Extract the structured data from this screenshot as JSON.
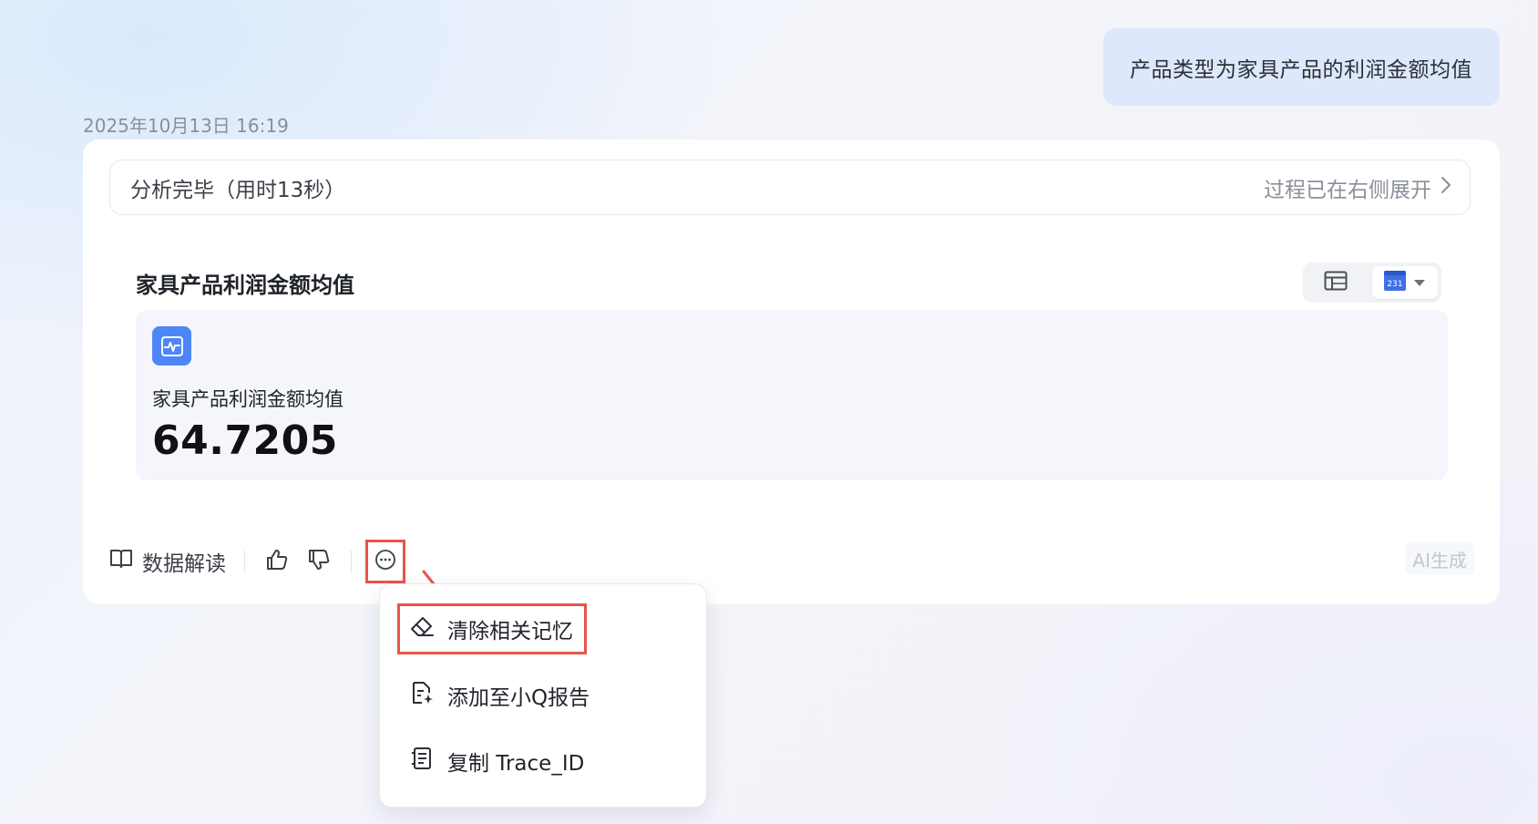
{
  "user_message": {
    "text": "产品类型为家具产品的利润金额均值"
  },
  "answer": {
    "timestamp": "2025年10月13日 16:19",
    "status": {
      "label": "分析完毕（用时13秒）",
      "process_link": "过程已在右侧展开"
    },
    "result": {
      "title": "家具产品利润金额均值",
      "view_switch": {
        "options": [
          "table",
          "indicator-card"
        ],
        "selected": "indicator-card",
        "indicator_glyph_text": "231"
      },
      "metric": {
        "icon": "pulse-chart-icon",
        "label": "家具产品利润金额均值",
        "value": "64.7205"
      }
    },
    "actions": {
      "interpret_label": "数据解读",
      "like_icon": "thumbs-up-icon",
      "dislike_icon": "thumbs-down-icon",
      "more_icon": "more-dots-icon"
    },
    "ai_badge": "AI生成"
  },
  "more_menu": {
    "items": [
      {
        "icon": "eraser-icon",
        "label": "清除相关记忆",
        "highlighted": true
      },
      {
        "icon": "report-add-icon",
        "label": "添加至小Q报告",
        "highlighted": false
      },
      {
        "icon": "document-list-icon",
        "label": "复制 Trace_ID",
        "highlighted": false
      }
    ]
  },
  "colors": {
    "accent": "#4e86f7",
    "user_bubble": "#dde8fc",
    "highlight_box": "#e8544a"
  }
}
